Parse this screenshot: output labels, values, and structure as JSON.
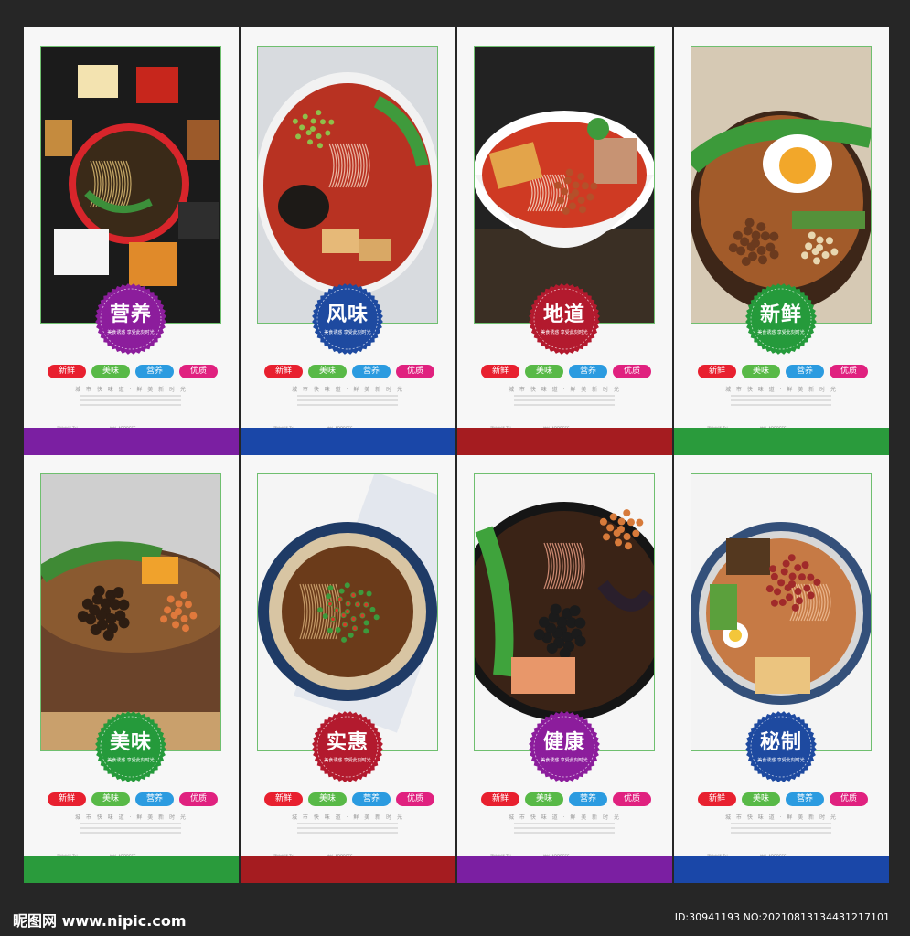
{
  "pill_labels": [
    "新鲜",
    "美味",
    "营养",
    "优质"
  ],
  "pill_colors": [
    "#e8202f",
    "#58b947",
    "#2b9be0",
    "#e0217f"
  ],
  "slogan": "城 市 快 味 道   ·   鲜 美 新 时 光",
  "tagline": "美食诱惑 享受此刻时光",
  "contact": {
    "phone_label": "预约电话 Tel",
    "address_label": "地址 ADDRESS",
    "phone": "0888-66669999",
    "address": "某某市某某区某某路88号某某商业广场"
  },
  "cards": [
    {
      "title": "营养",
      "theme": "#8c1d9c",
      "band": "#7b1fa2",
      "scene": "platter"
    },
    {
      "title": "风味",
      "theme": "#1e4aa0",
      "band": "#1a47a8",
      "scene": "redsoup"
    },
    {
      "title": "地道",
      "theme": "#b31a2e",
      "band": "#a51c20",
      "scene": "whitebowl"
    },
    {
      "title": "新鲜",
      "theme": "#259a3b",
      "band": "#2a9b3c",
      "scene": "claypot"
    },
    {
      "title": "美味",
      "theme": "#259a3b",
      "band": "#2a9b3c",
      "scene": "claypot2"
    },
    {
      "title": "实惠",
      "theme": "#b31a2e",
      "band": "#a51c20",
      "scene": "bluebowl"
    },
    {
      "title": "健康",
      "theme": "#8c1d9c",
      "band": "#7b1fa2",
      "scene": "dark"
    },
    {
      "title": "秘制",
      "theme": "#1e4aa0",
      "band": "#1a47a8",
      "scene": "bluebowl2"
    }
  ],
  "footer": {
    "site": "昵图网 www.nipic.com",
    "id": "ID:30941193 NO:20210813134431217101"
  }
}
